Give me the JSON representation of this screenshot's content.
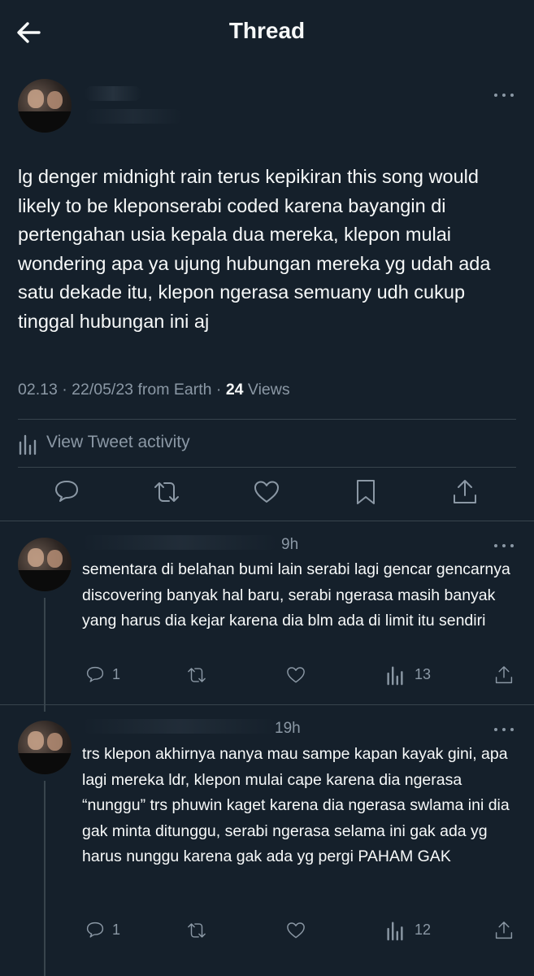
{
  "header": {
    "title": "Thread"
  },
  "tweet": {
    "text": "lg denger midnight rain terus kepikiran this song would likely to be kleponserabi coded karena bayangin di pertengahan usia kepala dua mereka, klepon mulai wondering apa ya ujung hubungan mereka yg udah ada satu dekade itu, klepon ngerasa semuany udh cukup tinggal hubungan ini aj",
    "meta_prefix": "02.13 · 22/05/23 from Earth · ",
    "views_count": "24",
    "views_label": " Views",
    "activity_label": "View Tweet activity"
  },
  "replies": [
    {
      "time": "9h",
      "text": "sementara di belahan bumi lain serabi lagi gencar gencarnya discovering banyak hal baru, serabi ngerasa masih banyak yang harus dia kejar karena dia blm ada di limit itu sendiri",
      "reply_count": "1",
      "views": "13"
    },
    {
      "time": "19h",
      "text": "trs klepon akhirnya nanya mau sampe kapan kayak gini, apa lagi mereka ldr, klepon mulai cape karena dia ngerasa “nunggu” trs phuwin kaget karena dia ngerasa swlama ini dia gak minta ditunggu, serabi ngerasa selama ini gak ada yg harus nunggu karena gak ada yg pergi PAHAM GAK",
      "reply_count": "1",
      "views": "12"
    }
  ],
  "colors": {
    "background": "#15202b",
    "text": "#f7f9f9",
    "muted": "#8b98a5",
    "divider": "#38444d"
  },
  "icons": [
    "back-arrow-icon",
    "more-icon",
    "bar-chart-icon",
    "reply-icon",
    "retweet-icon",
    "like-icon",
    "bookmark-icon",
    "share-icon",
    "views-icon"
  ]
}
